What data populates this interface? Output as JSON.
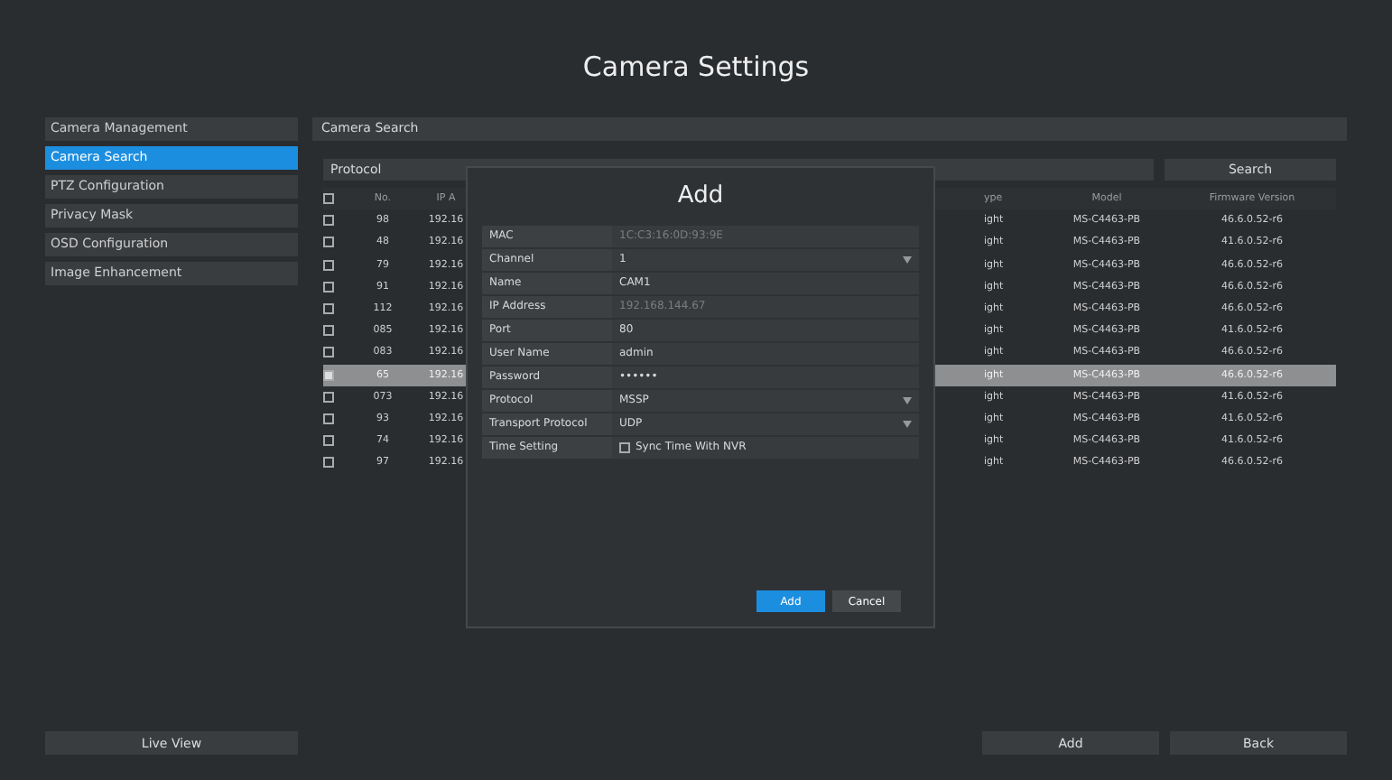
{
  "window": {
    "title": "Camera Settings"
  },
  "sidebar": {
    "items": [
      {
        "label": "Camera Management",
        "selected": false
      },
      {
        "label": "Camera Search",
        "selected": true
      },
      {
        "label": "PTZ Configuration",
        "selected": false
      },
      {
        "label": "Privacy Mask",
        "selected": false
      },
      {
        "label": "OSD Configuration",
        "selected": false
      },
      {
        "label": "Image Enhancement",
        "selected": false
      }
    ]
  },
  "section_title": "Camera Search",
  "filter": {
    "label": "Protocol",
    "button": "Search"
  },
  "table": {
    "select_all_checked": false,
    "columns": [
      "No.",
      "IP A",
      "ype",
      "Model",
      "Firmware Version"
    ],
    "rows": [
      {
        "selected": false,
        "cells": [
          "98",
          "192.16",
          "ight",
          "MS-C4463-PB",
          "46.6.0.52-r6"
        ]
      },
      {
        "selected": false,
        "cells": [
          "48",
          "192.16",
          "ight",
          "MS-C4463-PB",
          "41.6.0.52-r6"
        ]
      },
      {
        "selected": false,
        "cells": [
          "79",
          "192.16",
          "ight",
          "MS-C4463-PB",
          "46.6.0.52-r6"
        ]
      },
      {
        "selected": false,
        "cells": [
          "91",
          "192.16",
          "ight",
          "MS-C4463-PB",
          "46.6.0.52-r6"
        ]
      },
      {
        "selected": false,
        "cells": [
          "112",
          "192.16",
          "ight",
          "MS-C4463-PB",
          "46.6.0.52-r6"
        ]
      },
      {
        "selected": false,
        "cells": [
          "085",
          "192.16",
          "ight",
          "MS-C4463-PB",
          "41.6.0.52-r6"
        ]
      },
      {
        "selected": false,
        "cells": [
          "083",
          "192.16",
          "ight",
          "MS-C4463-PB",
          "46.6.0.52-r6"
        ]
      },
      {
        "selected": true,
        "cells": [
          "65",
          "192.16",
          "ight",
          "MS-C4463-PB",
          "46.6.0.52-r6"
        ]
      },
      {
        "selected": false,
        "cells": [
          "073",
          "192.16",
          "ight",
          "MS-C4463-PB",
          "41.6.0.52-r6"
        ]
      },
      {
        "selected": false,
        "cells": [
          "93",
          "192.16",
          "ight",
          "MS-C4463-PB",
          "41.6.0.52-r6"
        ]
      },
      {
        "selected": false,
        "cells": [
          "74",
          "192.16",
          "ight",
          "MS-C4463-PB",
          "41.6.0.52-r6"
        ]
      },
      {
        "selected": false,
        "cells": [
          "97",
          "192.16",
          "ight",
          "MS-C4463-PB",
          "46.6.0.52-r6"
        ]
      }
    ]
  },
  "dialog": {
    "title": "Add",
    "fields": [
      {
        "label": "MAC",
        "kind": "readonly",
        "value": "1C:C3:16:0D:93:9E"
      },
      {
        "label": "Channel",
        "kind": "select",
        "value": "1"
      },
      {
        "label": "Name",
        "kind": "text",
        "value": "CAM1"
      },
      {
        "label": "IP Address",
        "kind": "readonly",
        "value": "192.168.144.67"
      },
      {
        "label": "Port",
        "kind": "text",
        "value": "80"
      },
      {
        "label": "User Name",
        "kind": "text",
        "value": "admin"
      },
      {
        "label": "Password",
        "kind": "text",
        "value": "••••••"
      },
      {
        "label": "Protocol",
        "kind": "select",
        "value": "MSSP"
      },
      {
        "label": "Transport Protocol",
        "kind": "select",
        "value": "UDP"
      },
      {
        "label": "Time Setting",
        "kind": "checkbox",
        "value": "Sync Time With NVR",
        "checked": false
      }
    ],
    "buttons": [
      {
        "label": "Add",
        "primary": true
      },
      {
        "label": "Cancel",
        "primary": false
      }
    ]
  },
  "footer": {
    "left": "Live View",
    "buttons": [
      "Add",
      "Back"
    ]
  }
}
